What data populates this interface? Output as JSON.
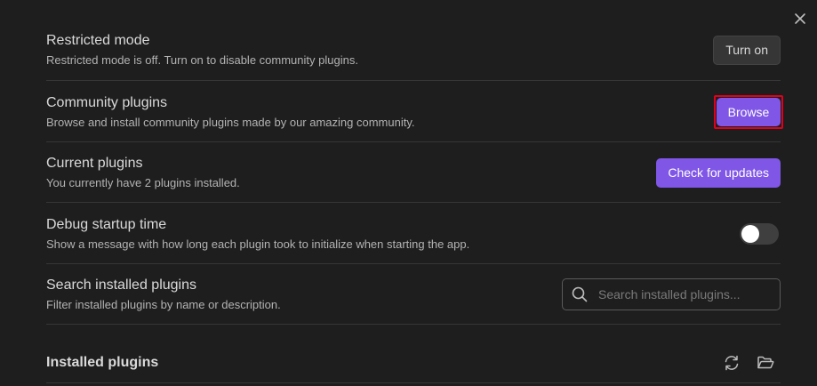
{
  "window": {
    "close_icon": "close-icon"
  },
  "settings": {
    "restricted_mode": {
      "name": "Restricted mode",
      "desc": "Restricted mode is off. Turn on to disable community plugins.",
      "button": "Turn on"
    },
    "community_plugins": {
      "name": "Community plugins",
      "desc": "Browse and install community plugins made by our amazing community.",
      "button": "Browse"
    },
    "current_plugins": {
      "name": "Current plugins",
      "desc": "You currently have 2 plugins installed.",
      "button": "Check for updates"
    },
    "debug_startup": {
      "name": "Debug startup time",
      "desc": "Show a message with how long each plugin took to initialize when starting the app.",
      "toggle_on": false
    },
    "search_installed": {
      "name": "Search installed plugins",
      "desc": "Filter installed plugins by name or description.",
      "placeholder": "Search installed plugins...",
      "value": ""
    }
  },
  "installed": {
    "title": "Installed plugins",
    "reload_icon": "reload-icon",
    "folder_icon": "open-folder-icon"
  },
  "colors": {
    "accent": "#7f56e6",
    "background": "#1e1e1e",
    "highlight_border": "#e0001b"
  }
}
